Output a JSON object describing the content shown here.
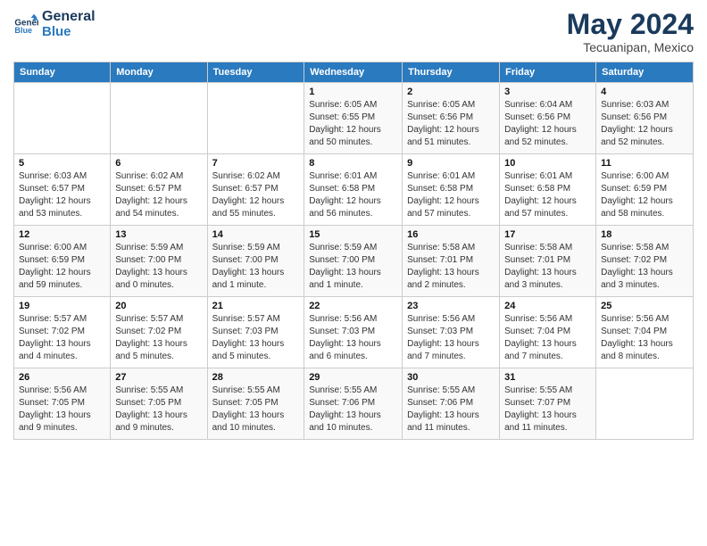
{
  "logo": {
    "text1": "General",
    "text2": "Blue"
  },
  "title": "May 2024",
  "subtitle": "Tecuanipan, Mexico",
  "days_header": [
    "Sunday",
    "Monday",
    "Tuesday",
    "Wednesday",
    "Thursday",
    "Friday",
    "Saturday"
  ],
  "weeks": [
    [
      {
        "num": "",
        "lines": []
      },
      {
        "num": "",
        "lines": []
      },
      {
        "num": "",
        "lines": []
      },
      {
        "num": "1",
        "lines": [
          "Sunrise: 6:05 AM",
          "Sunset: 6:55 PM",
          "Daylight: 12 hours",
          "and 50 minutes."
        ]
      },
      {
        "num": "2",
        "lines": [
          "Sunrise: 6:05 AM",
          "Sunset: 6:56 PM",
          "Daylight: 12 hours",
          "and 51 minutes."
        ]
      },
      {
        "num": "3",
        "lines": [
          "Sunrise: 6:04 AM",
          "Sunset: 6:56 PM",
          "Daylight: 12 hours",
          "and 52 minutes."
        ]
      },
      {
        "num": "4",
        "lines": [
          "Sunrise: 6:03 AM",
          "Sunset: 6:56 PM",
          "Daylight: 12 hours",
          "and 52 minutes."
        ]
      }
    ],
    [
      {
        "num": "5",
        "lines": [
          "Sunrise: 6:03 AM",
          "Sunset: 6:57 PM",
          "Daylight: 12 hours",
          "and 53 minutes."
        ]
      },
      {
        "num": "6",
        "lines": [
          "Sunrise: 6:02 AM",
          "Sunset: 6:57 PM",
          "Daylight: 12 hours",
          "and 54 minutes."
        ]
      },
      {
        "num": "7",
        "lines": [
          "Sunrise: 6:02 AM",
          "Sunset: 6:57 PM",
          "Daylight: 12 hours",
          "and 55 minutes."
        ]
      },
      {
        "num": "8",
        "lines": [
          "Sunrise: 6:01 AM",
          "Sunset: 6:58 PM",
          "Daylight: 12 hours",
          "and 56 minutes."
        ]
      },
      {
        "num": "9",
        "lines": [
          "Sunrise: 6:01 AM",
          "Sunset: 6:58 PM",
          "Daylight: 12 hours",
          "and 57 minutes."
        ]
      },
      {
        "num": "10",
        "lines": [
          "Sunrise: 6:01 AM",
          "Sunset: 6:58 PM",
          "Daylight: 12 hours",
          "and 57 minutes."
        ]
      },
      {
        "num": "11",
        "lines": [
          "Sunrise: 6:00 AM",
          "Sunset: 6:59 PM",
          "Daylight: 12 hours",
          "and 58 minutes."
        ]
      }
    ],
    [
      {
        "num": "12",
        "lines": [
          "Sunrise: 6:00 AM",
          "Sunset: 6:59 PM",
          "Daylight: 12 hours",
          "and 59 minutes."
        ]
      },
      {
        "num": "13",
        "lines": [
          "Sunrise: 5:59 AM",
          "Sunset: 7:00 PM",
          "Daylight: 13 hours",
          "and 0 minutes."
        ]
      },
      {
        "num": "14",
        "lines": [
          "Sunrise: 5:59 AM",
          "Sunset: 7:00 PM",
          "Daylight: 13 hours",
          "and 1 minute."
        ]
      },
      {
        "num": "15",
        "lines": [
          "Sunrise: 5:59 AM",
          "Sunset: 7:00 PM",
          "Daylight: 13 hours",
          "and 1 minute."
        ]
      },
      {
        "num": "16",
        "lines": [
          "Sunrise: 5:58 AM",
          "Sunset: 7:01 PM",
          "Daylight: 13 hours",
          "and 2 minutes."
        ]
      },
      {
        "num": "17",
        "lines": [
          "Sunrise: 5:58 AM",
          "Sunset: 7:01 PM",
          "Daylight: 13 hours",
          "and 3 minutes."
        ]
      },
      {
        "num": "18",
        "lines": [
          "Sunrise: 5:58 AM",
          "Sunset: 7:02 PM",
          "Daylight: 13 hours",
          "and 3 minutes."
        ]
      }
    ],
    [
      {
        "num": "19",
        "lines": [
          "Sunrise: 5:57 AM",
          "Sunset: 7:02 PM",
          "Daylight: 13 hours",
          "and 4 minutes."
        ]
      },
      {
        "num": "20",
        "lines": [
          "Sunrise: 5:57 AM",
          "Sunset: 7:02 PM",
          "Daylight: 13 hours",
          "and 5 minutes."
        ]
      },
      {
        "num": "21",
        "lines": [
          "Sunrise: 5:57 AM",
          "Sunset: 7:03 PM",
          "Daylight: 13 hours",
          "and 5 minutes."
        ]
      },
      {
        "num": "22",
        "lines": [
          "Sunrise: 5:56 AM",
          "Sunset: 7:03 PM",
          "Daylight: 13 hours",
          "and 6 minutes."
        ]
      },
      {
        "num": "23",
        "lines": [
          "Sunrise: 5:56 AM",
          "Sunset: 7:03 PM",
          "Daylight: 13 hours",
          "and 7 minutes."
        ]
      },
      {
        "num": "24",
        "lines": [
          "Sunrise: 5:56 AM",
          "Sunset: 7:04 PM",
          "Daylight: 13 hours",
          "and 7 minutes."
        ]
      },
      {
        "num": "25",
        "lines": [
          "Sunrise: 5:56 AM",
          "Sunset: 7:04 PM",
          "Daylight: 13 hours",
          "and 8 minutes."
        ]
      }
    ],
    [
      {
        "num": "26",
        "lines": [
          "Sunrise: 5:56 AM",
          "Sunset: 7:05 PM",
          "Daylight: 13 hours",
          "and 9 minutes."
        ]
      },
      {
        "num": "27",
        "lines": [
          "Sunrise: 5:55 AM",
          "Sunset: 7:05 PM",
          "Daylight: 13 hours",
          "and 9 minutes."
        ]
      },
      {
        "num": "28",
        "lines": [
          "Sunrise: 5:55 AM",
          "Sunset: 7:05 PM",
          "Daylight: 13 hours",
          "and 10 minutes."
        ]
      },
      {
        "num": "29",
        "lines": [
          "Sunrise: 5:55 AM",
          "Sunset: 7:06 PM",
          "Daylight: 13 hours",
          "and 10 minutes."
        ]
      },
      {
        "num": "30",
        "lines": [
          "Sunrise: 5:55 AM",
          "Sunset: 7:06 PM",
          "Daylight: 13 hours",
          "and 11 minutes."
        ]
      },
      {
        "num": "31",
        "lines": [
          "Sunrise: 5:55 AM",
          "Sunset: 7:07 PM",
          "Daylight: 13 hours",
          "and 11 minutes."
        ]
      },
      {
        "num": "",
        "lines": []
      }
    ]
  ]
}
